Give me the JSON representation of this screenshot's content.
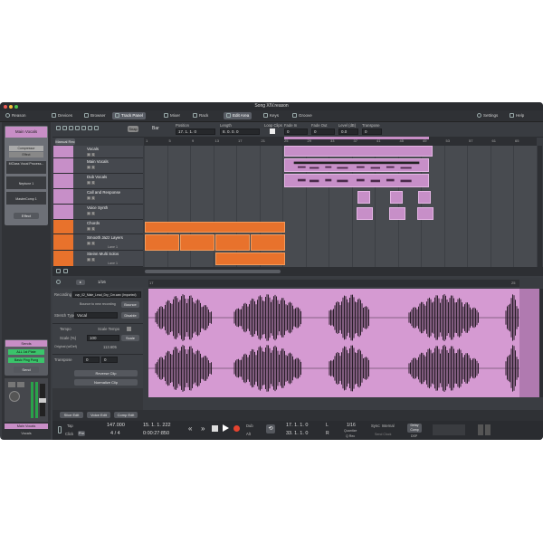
{
  "window": {
    "title": "Song XIV.reason"
  },
  "nav": {
    "logo": "Reason",
    "items": [
      {
        "label": "Devices",
        "icon": "devices-icon"
      },
      {
        "label": "Browser",
        "icon": "browser-icon"
      },
      {
        "label": "Track Panel",
        "icon": "track-panel-icon"
      },
      {
        "label": "Mixer",
        "icon": "mixer-icon"
      },
      {
        "label": "Rack",
        "icon": "rack-icon"
      },
      {
        "label": "Edit Area",
        "icon": "edit-area-icon"
      },
      {
        "label": "Keys",
        "icon": "keys-icon"
      },
      {
        "label": "Groove",
        "icon": "groove-icon"
      }
    ],
    "settings": "Settings",
    "help": "Help"
  },
  "inspector": {
    "snap": "Snap",
    "bar": "Bar",
    "position_label": "Position",
    "position": "17. 1. 1. 0",
    "length_label": "Length",
    "length": "8. 0. 0. 0",
    "loop_label": "Loop Clips",
    "fade_in_label": "Fade In",
    "fade_in": "0",
    "fade_out_label": "Fade Out",
    "fade_out": "0",
    "level_label": "Level (dB)",
    "level": "0.0",
    "transpose_label": "Transpose",
    "transpose": "0"
  },
  "manual_rec": "Manual Rec",
  "ruler": [
    "1",
    "5",
    "9",
    "13",
    "17",
    "21",
    "25",
    "29",
    "33",
    "37",
    "41",
    "45",
    "49",
    "53",
    "57",
    "61",
    "65"
  ],
  "left_panel": {
    "top_title": "Main Vocals",
    "compressor": "Compressor",
    "effect": "Effect",
    "mclass": "MClass Vocal Process...",
    "neptune": "Neptune 1",
    "mastercomp": "MasterComp 1",
    "effect_btn": "Effect",
    "sends": "Sends",
    "send1": "ALL 1st Plate",
    "send2": "Basic Ping Pong",
    "send_btn": "Send",
    "bottom_title": "Main Vocals",
    "bottom_sub": "Vocals"
  },
  "tracks": [
    {
      "name": "Vocals",
      "type": "folder"
    },
    {
      "name": "Main Vocals",
      "type": "track"
    },
    {
      "name": "Dub Vocals",
      "type": "track"
    },
    {
      "name": "Call and Response",
      "type": "track"
    },
    {
      "name": "Voice Synth",
      "type": "track"
    },
    {
      "name": "Chords",
      "type": "folder"
    },
    {
      "name": "Smooth Jazz Layers",
      "type": "track",
      "lane": "Lane 1"
    },
    {
      "name": "Steinn Multi Solos",
      "type": "track",
      "lane": "Lane 1"
    }
  ],
  "editor": {
    "grid": "1/16",
    "recording_label": "Recording",
    "recording_file": "cvp_02_Male_Lead_Dry_Cm.wav (Imported)",
    "bounce_label": "Bounce to new recording",
    "bounce_btn": "Bounce",
    "stretch_label": "Stretch Type",
    "stretch_value": "Vocal",
    "disable_btn": "Disable",
    "tempo_label": "Tempo",
    "scale_tempo": "Scale Tempo",
    "scale_label": "Scale (%)",
    "scale_value": "100",
    "scale_btn": "Scale",
    "original_label": "Original (w/Def)",
    "original_value": "113.605",
    "transpose_label": "Transpose",
    "transpose_value": "0",
    "transpose_fine": "0",
    "reverse_btn": "Reverse Clip",
    "normalize_btn": "Normalize Clip",
    "slice_edit": "Slice Edit",
    "voice_edit": "Voice Edit",
    "comp_edit": "Comp Edit",
    "ruler": [
      "17",
      "",
      "",
      "",
      "",
      "",
      "",
      "",
      "",
      "",
      "",
      "",
      "",
      "",
      "",
      "",
      "25"
    ]
  },
  "transport": {
    "tap": "Tap",
    "click": "Click",
    "pre": "Pre",
    "tempo": "147.000",
    "signature": "4 / 4",
    "bars": "15. 1. 1. 222",
    "time": "0:00:27:850",
    "dub": "Dub",
    "alt": "Alt",
    "loop_start": "17. 1. 1. 0",
    "loop_end": "33. 1. 1. 0",
    "L": "L",
    "R": "R",
    "quantize": "1/16",
    "quantize_label": "Quantize",
    "q_rec": "Q Rec",
    "sync": "Sync: Internal",
    "send_clock": "Send Clock",
    "delay_comp": "Delay Comp",
    "dsp": "DSP"
  },
  "colors": {
    "vocal_clip": "#c78fc8",
    "chord_clip": "#e8722c",
    "editor_bg": "#d59ad2",
    "accent_green": "#3ac46a"
  }
}
